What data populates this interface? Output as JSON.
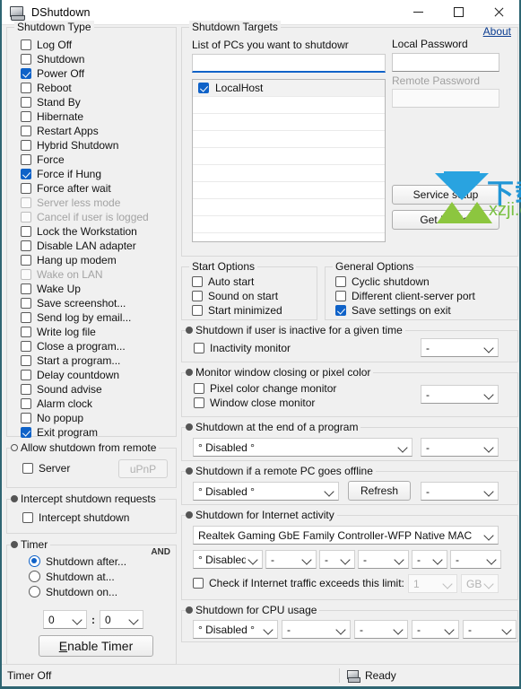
{
  "window": {
    "title": "DShutdown",
    "icon": "monitor-icon",
    "minimize": "–",
    "maximize": "□",
    "close": "✕"
  },
  "shutdown_type": {
    "legend": "Shutdown Type",
    "items": [
      {
        "label": "Log Off",
        "checked": false,
        "disabled": false
      },
      {
        "label": "Shutdown",
        "checked": false,
        "disabled": false
      },
      {
        "label": "Power Off",
        "checked": true,
        "disabled": false
      },
      {
        "label": "Reboot",
        "checked": false,
        "disabled": false
      },
      {
        "label": "Stand By",
        "checked": false,
        "disabled": false
      },
      {
        "label": "Hibernate",
        "checked": false,
        "disabled": false
      },
      {
        "label": "Restart Apps",
        "checked": false,
        "disabled": false
      },
      {
        "label": "Hybrid Shutdown",
        "checked": false,
        "disabled": false
      },
      {
        "label": "Force",
        "checked": false,
        "disabled": false
      },
      {
        "label": "Force if Hung",
        "checked": true,
        "disabled": false
      },
      {
        "label": "Force after wait",
        "checked": false,
        "disabled": false
      },
      {
        "label": "Server less mode",
        "checked": false,
        "disabled": true
      },
      {
        "label": "Cancel if user is logged",
        "checked": false,
        "disabled": true
      },
      {
        "label": "Lock the Workstation",
        "checked": false,
        "disabled": false
      },
      {
        "label": "Disable LAN adapter",
        "checked": false,
        "disabled": false
      },
      {
        "label": "Hang up modem",
        "checked": false,
        "disabled": false
      },
      {
        "label": "Wake on LAN",
        "checked": false,
        "disabled": true
      },
      {
        "label": "Wake Up",
        "checked": false,
        "disabled": false
      },
      {
        "label": "Save screenshot...",
        "checked": false,
        "disabled": false
      },
      {
        "label": "Send log by email...",
        "checked": false,
        "disabled": false
      },
      {
        "label": "Write log file",
        "checked": false,
        "disabled": false
      },
      {
        "label": "Close a program...",
        "checked": false,
        "disabled": false
      },
      {
        "label": "Start a program...",
        "checked": false,
        "disabled": false
      },
      {
        "label": "Delay countdown",
        "checked": false,
        "disabled": false
      },
      {
        "label": "Sound advise",
        "checked": false,
        "disabled": false
      },
      {
        "label": "Alarm clock",
        "checked": false,
        "disabled": false
      },
      {
        "label": "No popup",
        "checked": false,
        "disabled": false
      },
      {
        "label": "Exit program",
        "checked": true,
        "disabled": false
      }
    ]
  },
  "allow_remote": {
    "legend": "Allow shutdown from remote",
    "server_label": "Server",
    "server_checked": false,
    "upnp_label": "uPnP",
    "upnp_disabled": true
  },
  "intercept": {
    "legend": "Intercept shutdown requests",
    "checkbox_label": "Intercept shutdown",
    "checked": false
  },
  "timer": {
    "legend": "Timer",
    "and_label": "AND",
    "options": [
      {
        "label": "Shutdown after...",
        "selected": true
      },
      {
        "label": "Shutdown at...",
        "selected": false
      },
      {
        "label": "Shutdown on...",
        "selected": false
      }
    ],
    "hours": "0",
    "minutes": "0",
    "separator": ":",
    "enable_button": "Enable Timer"
  },
  "targets": {
    "legend": "Shutdown Targets",
    "about_link": "About",
    "list_label": "List of PCs you want to shutdowr",
    "pc_input_value": "",
    "local_password_label": "Local Password",
    "local_password_value": "",
    "remote_password_label": "Remote Password",
    "remote_password_value": "",
    "remote_password_disabled": true,
    "pc_list": [
      {
        "name": "LocalHost",
        "checked": true
      }
    ],
    "service_setup_button": "Service setup",
    "get_pc_list_button": "Get PC list"
  },
  "start_options": {
    "legend": "Start Options",
    "items": [
      {
        "label": "Auto start",
        "checked": false
      },
      {
        "label": "Sound on start",
        "checked": false
      },
      {
        "label": "Start minimized",
        "checked": false
      }
    ]
  },
  "general_options": {
    "legend": "General Options",
    "items": [
      {
        "label": "Cyclic shutdown",
        "checked": false
      },
      {
        "label": "Different client-server port",
        "checked": false
      },
      {
        "label": "Save settings on exit",
        "checked": true
      }
    ]
  },
  "inactivity": {
    "legend": "Shutdown if user is inactive for a given time",
    "checkbox_label": "Inactivity monitor",
    "checked": false,
    "combo_value": "-"
  },
  "monitor_window": {
    "legend": "Monitor window closing or pixel color",
    "items": [
      {
        "label": "Pixel color change monitor",
        "checked": false
      },
      {
        "label": "Window close monitor",
        "checked": false
      }
    ],
    "combo_value": "-"
  },
  "end_of_program": {
    "legend": "Shutdown at the end of a program",
    "combo_main": "° Disabled °",
    "combo_second": "-"
  },
  "remote_offline": {
    "legend": "Shutdown if a remote PC goes offline",
    "combo_main": "° Disabled °",
    "refresh_button": "Refresh",
    "combo_second": "-"
  },
  "internet_activity": {
    "legend": "Shutdown for Internet activity",
    "adapter": "Realtek Gaming GbE Family Controller-WFP Native MAC",
    "combos": [
      "° Disabled °",
      "-",
      "-",
      "-",
      "-",
      "-"
    ],
    "traffic_checkbox": "Check if Internet traffic exceeds this limit:",
    "traffic_checked": false,
    "traffic_value": "1",
    "traffic_unit": "GB"
  },
  "cpu_usage": {
    "legend": "Shutdown for CPU usage",
    "combos": [
      "° Disabled °",
      "-",
      "-",
      "-",
      "-"
    ]
  },
  "statusbar": {
    "timer_status": "Timer Off",
    "ready_status": "Ready",
    "ready_icon": "monitor-icon"
  },
  "watermark": {
    "cn_text": "下载集",
    "en_text": "xzji.com"
  }
}
